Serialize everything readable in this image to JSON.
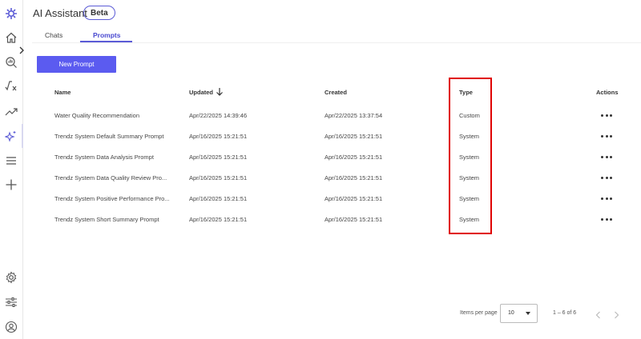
{
  "header": {
    "title": "AI Assistant",
    "badge": "Beta"
  },
  "tabs": [
    {
      "label": "Chats",
      "active": false
    },
    {
      "label": "Prompts",
      "active": true
    }
  ],
  "toolbar": {
    "new_prompt_label": "New Prompt"
  },
  "table": {
    "headers": {
      "name": "Name",
      "updated": "Updated",
      "created": "Created",
      "type": "Type",
      "actions": "Actions"
    },
    "sort": {
      "column": "updated",
      "direction": "descending"
    },
    "rows": [
      {
        "name": "Water Quality Recommendation",
        "updated": "Apr/22/2025 14:39:46",
        "created": "Apr/22/2025 13:37:54",
        "type": "Custom"
      },
      {
        "name": "Trendz System Default Summary Prompt",
        "updated": "Apr/16/2025 15:21:51",
        "created": "Apr/16/2025 15:21:51",
        "type": "System"
      },
      {
        "name": "Trendz System Data Analysis Prompt",
        "updated": "Apr/16/2025 15:21:51",
        "created": "Apr/16/2025 15:21:51",
        "type": "System"
      },
      {
        "name": "Trendz System Data Quality Review Pro...",
        "updated": "Apr/16/2025 15:21:51",
        "created": "Apr/16/2025 15:21:51",
        "type": "System"
      },
      {
        "name": "Trendz System Positive Performance Pro...",
        "updated": "Apr/16/2025 15:21:51",
        "created": "Apr/16/2025 15:21:51",
        "type": "System"
      },
      {
        "name": "Trendz System Short Summary Prompt",
        "updated": "Apr/16/2025 15:21:51",
        "created": "Apr/16/2025 15:21:51",
        "type": "System"
      }
    ]
  },
  "pagination": {
    "items_per_page_label": "Items per page",
    "page_size": "10",
    "range": "1 – 6 of 6"
  },
  "sidebar": {
    "icons": [
      "logo-icon",
      "home-icon",
      "search-analytics-icon",
      "formula-icon",
      "trend-icon",
      "ai-sparkle-icon",
      "menu-icon",
      "add-icon",
      "settings-icon",
      "sliders-icon",
      "user-icon"
    ],
    "active": "ai-sparkle-icon"
  },
  "colors": {
    "accent": "#5b5bf0",
    "highlight": "#e00000"
  }
}
